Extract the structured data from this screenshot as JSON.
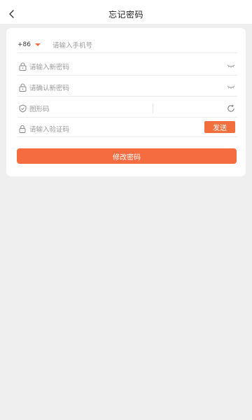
{
  "header": {
    "title": "忘记密码",
    "back_icon": "chevron-left-icon"
  },
  "form": {
    "country_code": "+86",
    "phone_placeholder": "请输入手机号",
    "new_password_placeholder": "请输入新密码",
    "confirm_password_placeholder": "请确认新密码",
    "captcha_placeholder": "图形码",
    "sms_code_placeholder": "请输入验证码",
    "send_label": "发送",
    "submit_label": "修改密码"
  },
  "colors": {
    "accent": "#f26e3c",
    "background": "#efefef",
    "card": "#ffffff"
  }
}
